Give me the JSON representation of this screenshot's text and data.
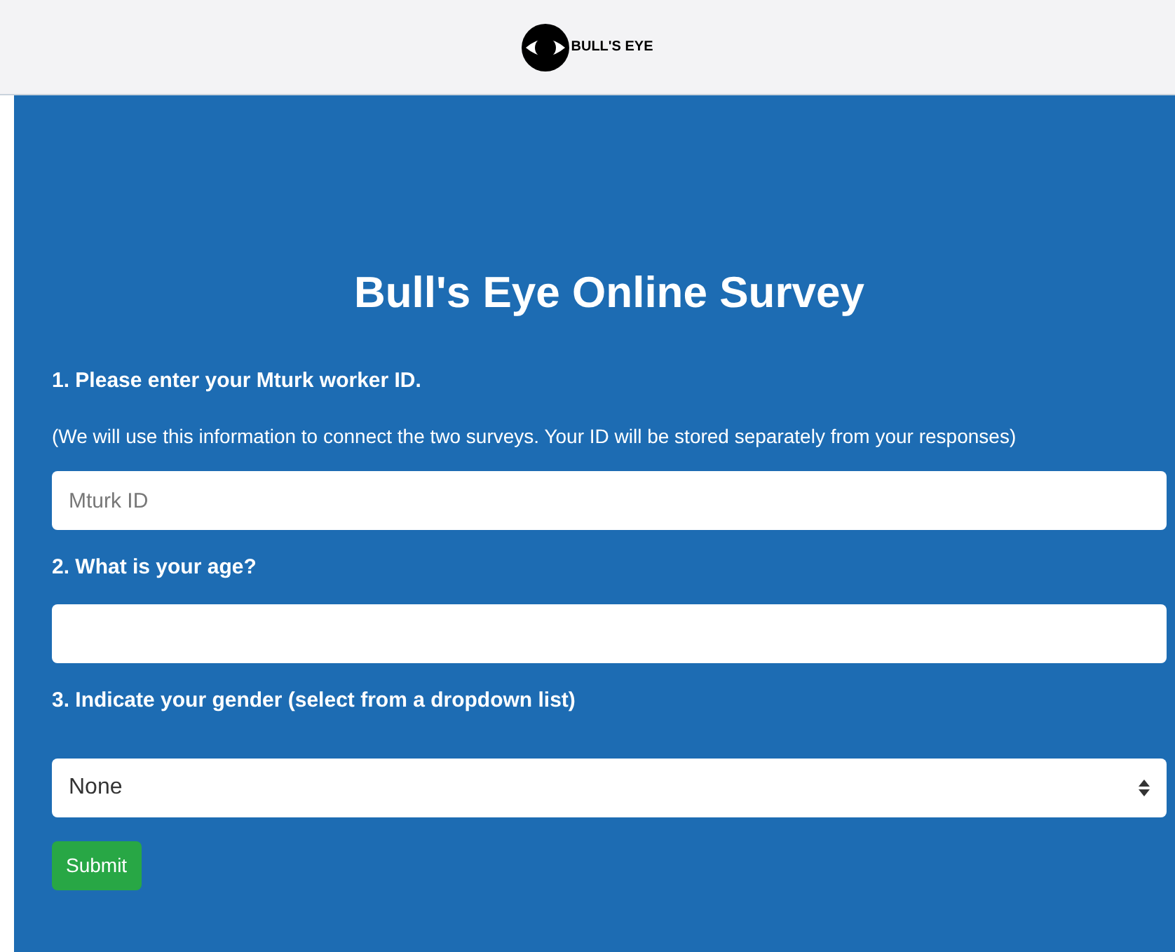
{
  "header": {
    "logo_text": "BULL'S EYE"
  },
  "title": "Bull's Eye Online Survey",
  "questions": [
    {
      "kind": "text",
      "label": "1. Please enter your Mturk worker ID.",
      "note": "(We will use this information to connect the two surveys. Your ID will be stored separately from your responses)",
      "placeholder": "Mturk ID"
    },
    {
      "kind": "text",
      "label": "2. What is your age?"
    },
    {
      "kind": "select",
      "label": "3. Indicate your gender (select from a dropdown list)",
      "value": "None"
    }
  ],
  "submit": "Submit"
}
